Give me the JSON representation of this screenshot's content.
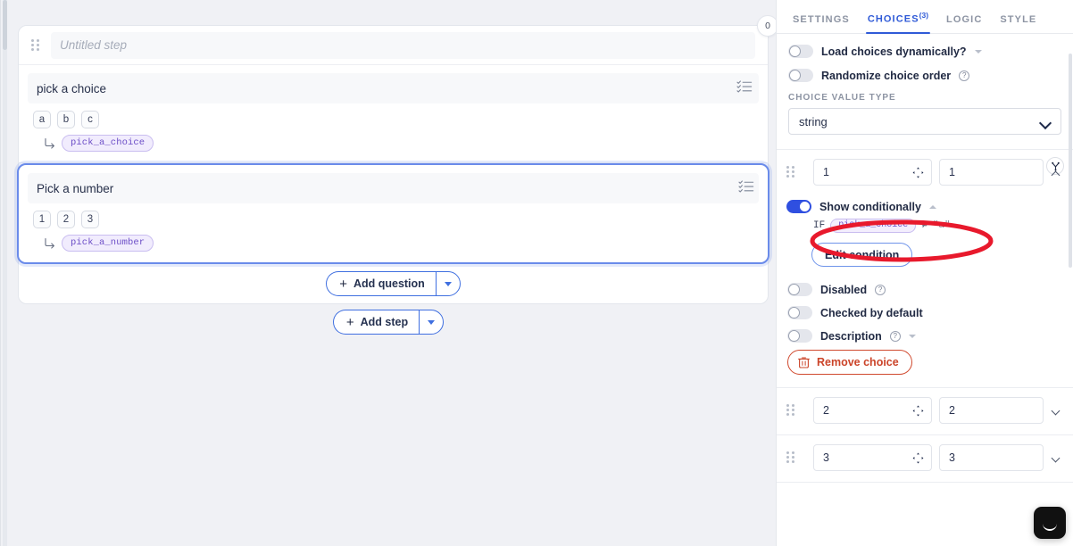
{
  "canvas": {
    "step": {
      "title_placeholder": "Untitled step",
      "badge_count": "0",
      "drag_handle_name": "step-drag-handle"
    },
    "questions": [
      {
        "title": "pick a choice",
        "options": [
          "a",
          "b",
          "c"
        ],
        "variable": "pick_a_choice",
        "selected": false
      },
      {
        "title": "Pick a number",
        "options": [
          "1",
          "2",
          "3"
        ],
        "variable": "pick_a_number",
        "selected": true
      }
    ],
    "add_question_label": "Add question",
    "add_step_label": "Add step"
  },
  "panel": {
    "tabs": [
      {
        "label": "SETTINGS",
        "sup": "",
        "active": false
      },
      {
        "label": "CHOICES",
        "sup": "(3)",
        "active": true
      },
      {
        "label": "LOGIC",
        "sup": "",
        "active": false
      },
      {
        "label": "STYLE",
        "sup": "",
        "active": false
      }
    ],
    "load_dynamically_label": "Load choices dynamically?",
    "randomize_label": "Randomize choice order",
    "choice_value_type_label": "CHOICE VALUE TYPE",
    "choice_value_type_value": "string",
    "choices": [
      {
        "value": "1",
        "label": "1",
        "expanded": true,
        "show_conditionally_label": "Show conditionally",
        "show_conditionally_on": true,
        "condition": {
          "if_keyword": "IF",
          "variable": "pick_a_choice",
          "operator": "≠",
          "value": "\"a\""
        },
        "edit_condition_label": "Edit condition",
        "disabled_label": "Disabled",
        "checked_by_default_label": "Checked by default",
        "description_label": "Description",
        "remove_choice_label": "Remove choice"
      },
      {
        "value": "2",
        "label": "2",
        "expanded": false
      },
      {
        "value": "3",
        "label": "3",
        "expanded": false
      }
    ]
  },
  "annotation": {
    "shape": "ellipse",
    "color": "#E8192C",
    "stroke_width": 5
  },
  "colors": {
    "accent_blue": "#2F5AD7",
    "toggle_on": "#2F4FE0",
    "canvas_bg": "#F0F1F5",
    "variable_pill": "#6D4FC7",
    "danger": "#CB4429",
    "selected_outline": "#6A8BEA"
  },
  "chat": {
    "icon": "chat-bubble-icon"
  }
}
